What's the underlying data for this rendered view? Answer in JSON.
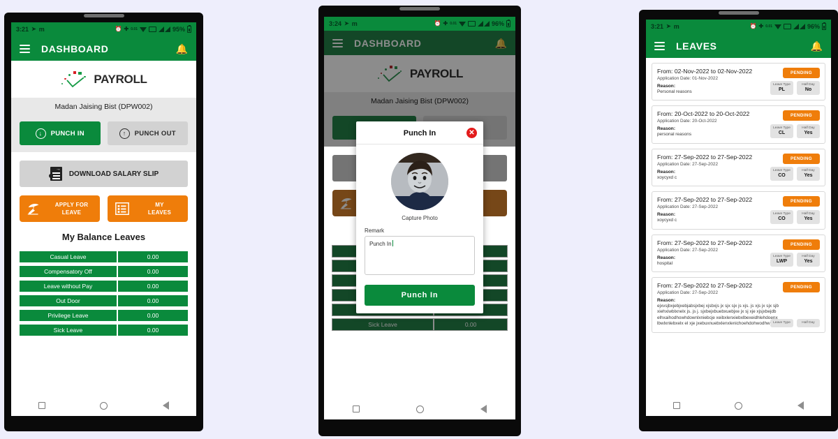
{
  "app": {
    "brand": "PAYROLL",
    "accent_green": "#0a8a3c",
    "accent_orange": "#ef7d0a",
    "page_background": "#eeeefc"
  },
  "phone1": {
    "status": {
      "time": "3:21",
      "location_icon": "location-arrow-icon",
      "carrier": "m",
      "alarm_icon": "alarm-icon",
      "bluetooth_icon": "bluetooth-icon",
      "data_rate": "0.01",
      "data_unit": "KB/S",
      "wifi_icon": "wifi-icon",
      "battery_percent": "95%"
    },
    "appbar": {
      "menu_icon": "hamburger-menu-icon",
      "title": "DASHBOARD",
      "bell_icon": "bell-icon"
    },
    "username": "Madan Jaising Bist (DPW002)",
    "punch_in": "PUNCH IN",
    "punch_out": "PUNCH OUT",
    "salary_slip": "DOWNLOAD SALARY SLIP",
    "apply_leave": "APPLY FOR\nLEAVE",
    "apply_leave_line1": "APPLY FOR",
    "apply_leave_line2": "LEAVE",
    "my_leaves_line1": "MY",
    "my_leaves_line2": "LEAVES",
    "balance_title": "My Balance Leaves",
    "balance_rows": [
      {
        "label": "Casual Leave",
        "value": "0.00"
      },
      {
        "label": "Compensatory Off",
        "value": "0.00"
      },
      {
        "label": "Leave without Pay",
        "value": "0.00"
      },
      {
        "label": "Out Door",
        "value": "0.00"
      },
      {
        "label": "Privilege Leave",
        "value": "0.00"
      },
      {
        "label": "Sick Leave",
        "value": "0.00"
      }
    ]
  },
  "phone2": {
    "status": {
      "time": "3:24",
      "carrier": "m",
      "data_rate": "0.01",
      "battery_percent": "96%"
    },
    "appbar": {
      "title": "DASHBOARD"
    },
    "modal": {
      "title": "Punch In",
      "close_icon": "close-icon",
      "avatar_caption": "Capture Photo",
      "remark_label": "Remark",
      "remark_value": "Punch In",
      "submit_label": "Punch In"
    }
  },
  "phone3": {
    "status": {
      "time": "3:21",
      "carrier": "m",
      "data_rate": "0.01",
      "battery_percent": "96%"
    },
    "appbar": {
      "title": "LEAVES"
    },
    "chip_labels": {
      "type": "Leave Type",
      "half": "Half Day"
    },
    "reason_label": "Reason:",
    "cards": [
      {
        "dates": "From: 02-Nov-2022 to 02-Nov-2022",
        "application_date": "Application Date: 01-Nov-2022",
        "reason": "Personal reasons",
        "status": "PENDING",
        "leave_type": "PL",
        "half_day": "No"
      },
      {
        "dates": "From: 20-Oct-2022 to 20-Oct-2022",
        "application_date": "Application Date: 20-Oct-2022",
        "reason": "personal reasons",
        "status": "PENDING",
        "leave_type": "CL",
        "half_day": "Yes"
      },
      {
        "dates": "From: 27-Sep-2022 to 27-Sep-2022",
        "application_date": "Application Date: 27-Sep-2022",
        "reason": "xoycyxd c",
        "status": "PENDING",
        "leave_type": "CO",
        "half_day": "Yes"
      },
      {
        "dates": "From: 27-Sep-2022 to 27-Sep-2022",
        "application_date": "Application Date: 27-Sep-2022",
        "reason": "xoycyxd c",
        "status": "PENDING",
        "leave_type": "CO",
        "half_day": "Yes"
      },
      {
        "dates": "From: 27-Sep-2022 to 27-Sep-2022",
        "application_date": "Application Date: 27-Sep-2022",
        "reason": "hospital",
        "status": "PENDING",
        "leave_type": "LWP",
        "half_day": "Yes"
      },
      {
        "dates": "From: 27-Sep-2022 to 27-Sep-2022",
        "application_date": "Application Date: 27-Sep-2022",
        "reason": "ejxvsjbxjebjxebjabsjxbej xjsbxjs jx sjx sjx js xjs. js xjs jx sjx sjbxiehxiwblxnelx js. js j. sjxbejxbuebxuebjxe jx sj xje xjsjxbejdbelhxaihodhowhdownlxniebcje xeibxlenxiebxlbexeidhlehdoenxlbwlxnlebxelx el xje jxebuxnuebxlenxlenichoehdohwodhw",
        "status": "PENDING",
        "leave_type": "Leave Type",
        "half_day": "Half Day"
      }
    ]
  },
  "navbar": {
    "recents_icon": "square-recents-icon",
    "home_icon": "circle-home-icon",
    "back_icon": "triangle-back-icon"
  }
}
